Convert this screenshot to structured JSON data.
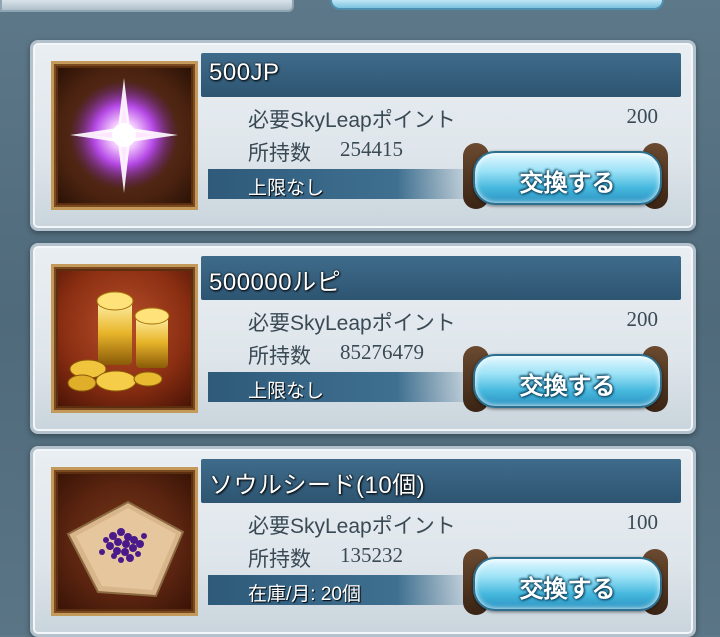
{
  "items": [
    {
      "name": "500JP",
      "required_label": "必要SkyLeapポイント",
      "required_value": "200",
      "owned_label": "所持数",
      "owned_value": "254415",
      "limit_text": "上限なし",
      "button_label": "交換する",
      "icon": "purple-crystal-icon"
    },
    {
      "name": "500000ルピ",
      "required_label": "必要SkyLeapポイント",
      "required_value": "200",
      "owned_label": "所持数",
      "owned_value": "85276479",
      "limit_text": "上限なし",
      "button_label": "交換する",
      "icon": "gold-coins-icon"
    },
    {
      "name": "ソウルシード(10個)",
      "required_label": "必要SkyLeapポイント",
      "required_value": "100",
      "owned_label": "所持数",
      "owned_value": "135232",
      "limit_text": "在庫/月: 20個",
      "button_label": "交換する",
      "icon": "soul-seed-icon"
    }
  ],
  "colors": {
    "name_bar": "#2d5572",
    "button": "#46b8de",
    "background": "#5d7888"
  }
}
